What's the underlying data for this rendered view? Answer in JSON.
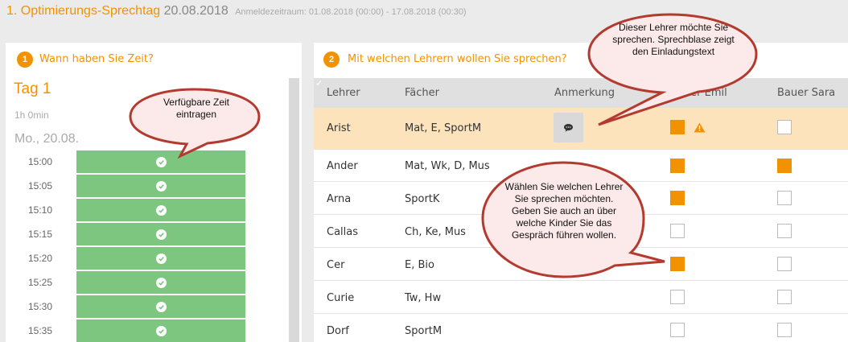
{
  "header": {
    "title": "1. Optimierungs-Sprechtag",
    "date": "20.08.2018",
    "range": "Anmeldezeitraum: 01.08.2018 (00:00) - 17.08.2018 (00:30)"
  },
  "panel1": {
    "step": "1",
    "heading": "Wann haben Sie Zeit?",
    "tag_title": "Tag 1",
    "duration": "1h 0min",
    "day": "Mo., 20.08.",
    "slots": [
      "15:00",
      "15:05",
      "15:10",
      "15:15",
      "15:20",
      "15:25",
      "15:30",
      "15:35"
    ]
  },
  "panel2": {
    "step": "2",
    "heading": "Mit welchen Lehrern wollen Sie sprechen?",
    "columns": [
      "Lehrer",
      "Fächer",
      "Anmerkung",
      "Bauer Emil",
      "Bauer Sara"
    ],
    "rows": [
      {
        "teacher": "Arist",
        "subjects": "Mat, E, SportM",
        "emil": true,
        "sara": false
      },
      {
        "teacher": "Ander",
        "subjects": "Mat, Wk, D, Mus",
        "emil": true,
        "sara": true
      },
      {
        "teacher": "Arna",
        "subjects": "SportK",
        "emil": true,
        "sara": false
      },
      {
        "teacher": "Callas",
        "subjects": "Ch, Ke, Mus",
        "emil": false,
        "sara": false
      },
      {
        "teacher": "Cer",
        "subjects": "E, Bio",
        "emil": true,
        "sara": false
      },
      {
        "teacher": "Curie",
        "subjects": "Tw, Hw",
        "emil": false,
        "sara": false
      },
      {
        "teacher": "Dorf",
        "subjects": "SportM",
        "emil": false,
        "sara": false
      }
    ]
  },
  "callouts": {
    "time": "Verfügbare Zeit eintragen",
    "teacher": "Dieser Lehrer möchte Sie sprechen. Sprechblase zeigt den Einladungstext",
    "choose": "Wählen Sie welchen Lehrer Sie sprechen möchten. Geben Sie auch an über welche Kinder Sie das Gespräch führen wollen."
  },
  "colors": {
    "accent": "#f39200",
    "slot_green": "#7dc67f",
    "row_highlight": "#fde3bc",
    "callout_fill": "#fce9e9",
    "callout_border": "#b33a2e"
  }
}
